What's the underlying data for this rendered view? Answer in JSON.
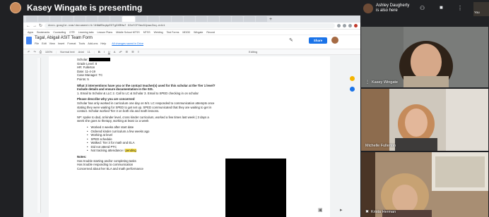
{
  "presenter": {
    "text": "Kasey Wingate is presenting"
  },
  "browser": {
    "url": "docs.google.com/document/d/1HAWEbqbpEXTg3XRHw7 X3nYCFfmu6JpwuZoq-edit",
    "bookmarks": [
      "Apps",
      "Bookmarks",
      "Counseling",
      "OTR",
      "Learning tabs",
      "Lesson Plans",
      "Middle School MTSS",
      "MTSS",
      "Welding",
      "Test Forms",
      "MDDD",
      "Wingate",
      "Record"
    ]
  },
  "doc": {
    "title": "Tagal, Abigail ASIT Team Form",
    "menu": [
      "File",
      "Edit",
      "View",
      "Insert",
      "Format",
      "Tools",
      "Add-ons",
      "Help"
    ],
    "last_edit": "All changes saved in Drive",
    "share_label": "Share",
    "toolbar": [
      "100%",
      "Normal text",
      "Arial",
      "11",
      "B",
      "I",
      "U",
      "A",
      "Editing"
    ],
    "lines": {
      "scholar": "Scholar:",
      "grade": "Grade Level: 8",
      "hr": "HR: Fullerton",
      "date": "Date: 11-4-19",
      "case": "Case Manager: TC",
      "points": "Points: 5",
      "q1": "What 3 interventions have you or the contact teacher(s) used for this scholar at the Tier 1 level?",
      "q1b": "Include details and ensure documentation in the SIS.",
      "a1": "1. Email to Scholar & LLC 2. Call to LC & Scholar 3. Email to SPED checking in on scholar",
      "q2": "Please describe why you are concerned",
      "a2a": "Scholar has only worked in curriculum one day on 9/4. LC responded to communication attempts once",
      "a2b": "stating they were waiting for SPED to get set up. SPED communicated that they are waiting to get in",
      "a2c": "contact. Scholar worked Tier 3 on both ela and math lessons.",
      "a3a": "NP: spoke to dad, at kinder level, cross kinder curriculum, worked a few times last week ( 3 days a",
      "a3b": "week she goes to therapy, working at least 1x a week",
      "notes": "Notes:",
      "n1": "Has trouble starting and/or completing tasks",
      "n2": "Has trouble responding to communication",
      "n3": "Concerned about her ELA and math performance"
    },
    "bullets": [
      "Worked 4 weeks after start date",
      "Ordered kinder curriculum a few weeks ago",
      "Working at level",
      "SPED schedule",
      "Walked: Tier 3 for math and ELA",
      "Did not attend PTC",
      "Not tracking attendance / "
    ],
    "highlight": "pending"
  },
  "participants": {
    "ashley": {
      "name": "Ashley Daugherty",
      "note": "is also here"
    },
    "you": "You",
    "tiles": [
      {
        "name": "Kasey Wingate"
      },
      {
        "name": "Michelle Fullerton"
      },
      {
        "name": "Krista Herman"
      }
    ]
  },
  "colors": {
    "accent": "#1a73e8",
    "highlight": "#fbe34b",
    "panel_bg": "#202124"
  }
}
